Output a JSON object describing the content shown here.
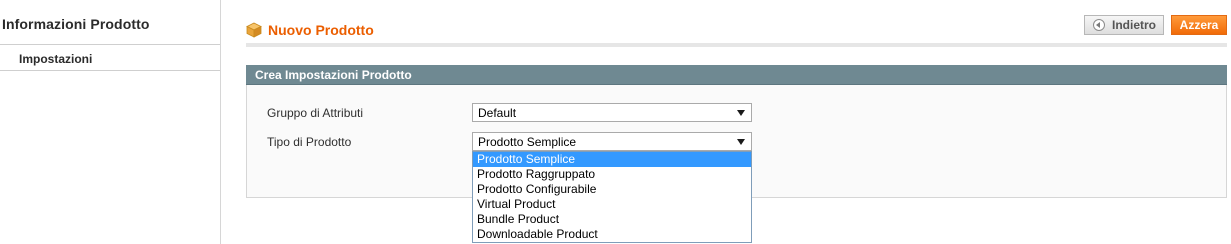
{
  "sidebar": {
    "title": "Informazioni Prodotto",
    "tabs": [
      {
        "label": "Impostazioni"
      }
    ]
  },
  "header": {
    "title": "Nuovo Prodotto",
    "back_label": "Indietro",
    "reset_label": "Azzera"
  },
  "section": {
    "title": "Crea Impostazioni Prodotto",
    "fields": [
      {
        "label": "Gruppo di Attributi",
        "value": "Default"
      },
      {
        "label": "Tipo di Prodotto",
        "value": "Prodotto Semplice"
      }
    ]
  },
  "dropdown": {
    "options": [
      "Prodotto Semplice",
      "Prodotto Raggruppato",
      "Prodotto Configurabile",
      "Virtual Product",
      "Bundle Product",
      "Downloadable Product"
    ],
    "highlighted": "Prodotto Semplice"
  },
  "colors": {
    "accent": "#eb5e00",
    "section_header": "#6f8992",
    "highlight": "#3399ff",
    "reset_button": "#f16b08"
  }
}
